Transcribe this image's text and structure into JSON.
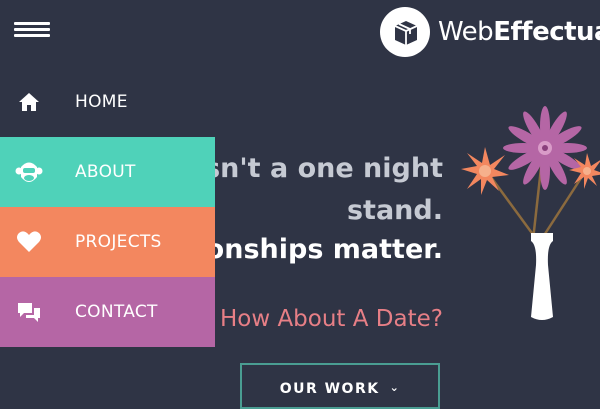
{
  "header": {
    "brand_prefix": "Web",
    "brand_bold": "Effectual",
    "menu_icon": "hamburger-icon",
    "logo_icon": "box-logo-icon"
  },
  "menu": {
    "items": [
      {
        "label": "HOME",
        "icon": "home-icon",
        "color": "#2f3445"
      },
      {
        "label": "ABOUT",
        "icon": "monkey-icon",
        "color": "#4fd2b9"
      },
      {
        "label": "PROJECTS",
        "icon": "heart-icon",
        "color": "#f3875f"
      },
      {
        "label": "CONTACT",
        "icon": "chat-icon",
        "color": "#b566a5"
      }
    ]
  },
  "hero": {
    "line1": "s isn't a one night",
    "line2": "stand.",
    "line3": "tionships matter.",
    "date_line": "o, How About A Date?",
    "cta_label": "OUR WORK",
    "cta_icon": "chevron-down-icon"
  },
  "colors": {
    "background": "#2f3445",
    "teal": "#4fd2b9",
    "orange": "#f3875f",
    "purple": "#b566a5",
    "pink_text": "#e77f86"
  }
}
